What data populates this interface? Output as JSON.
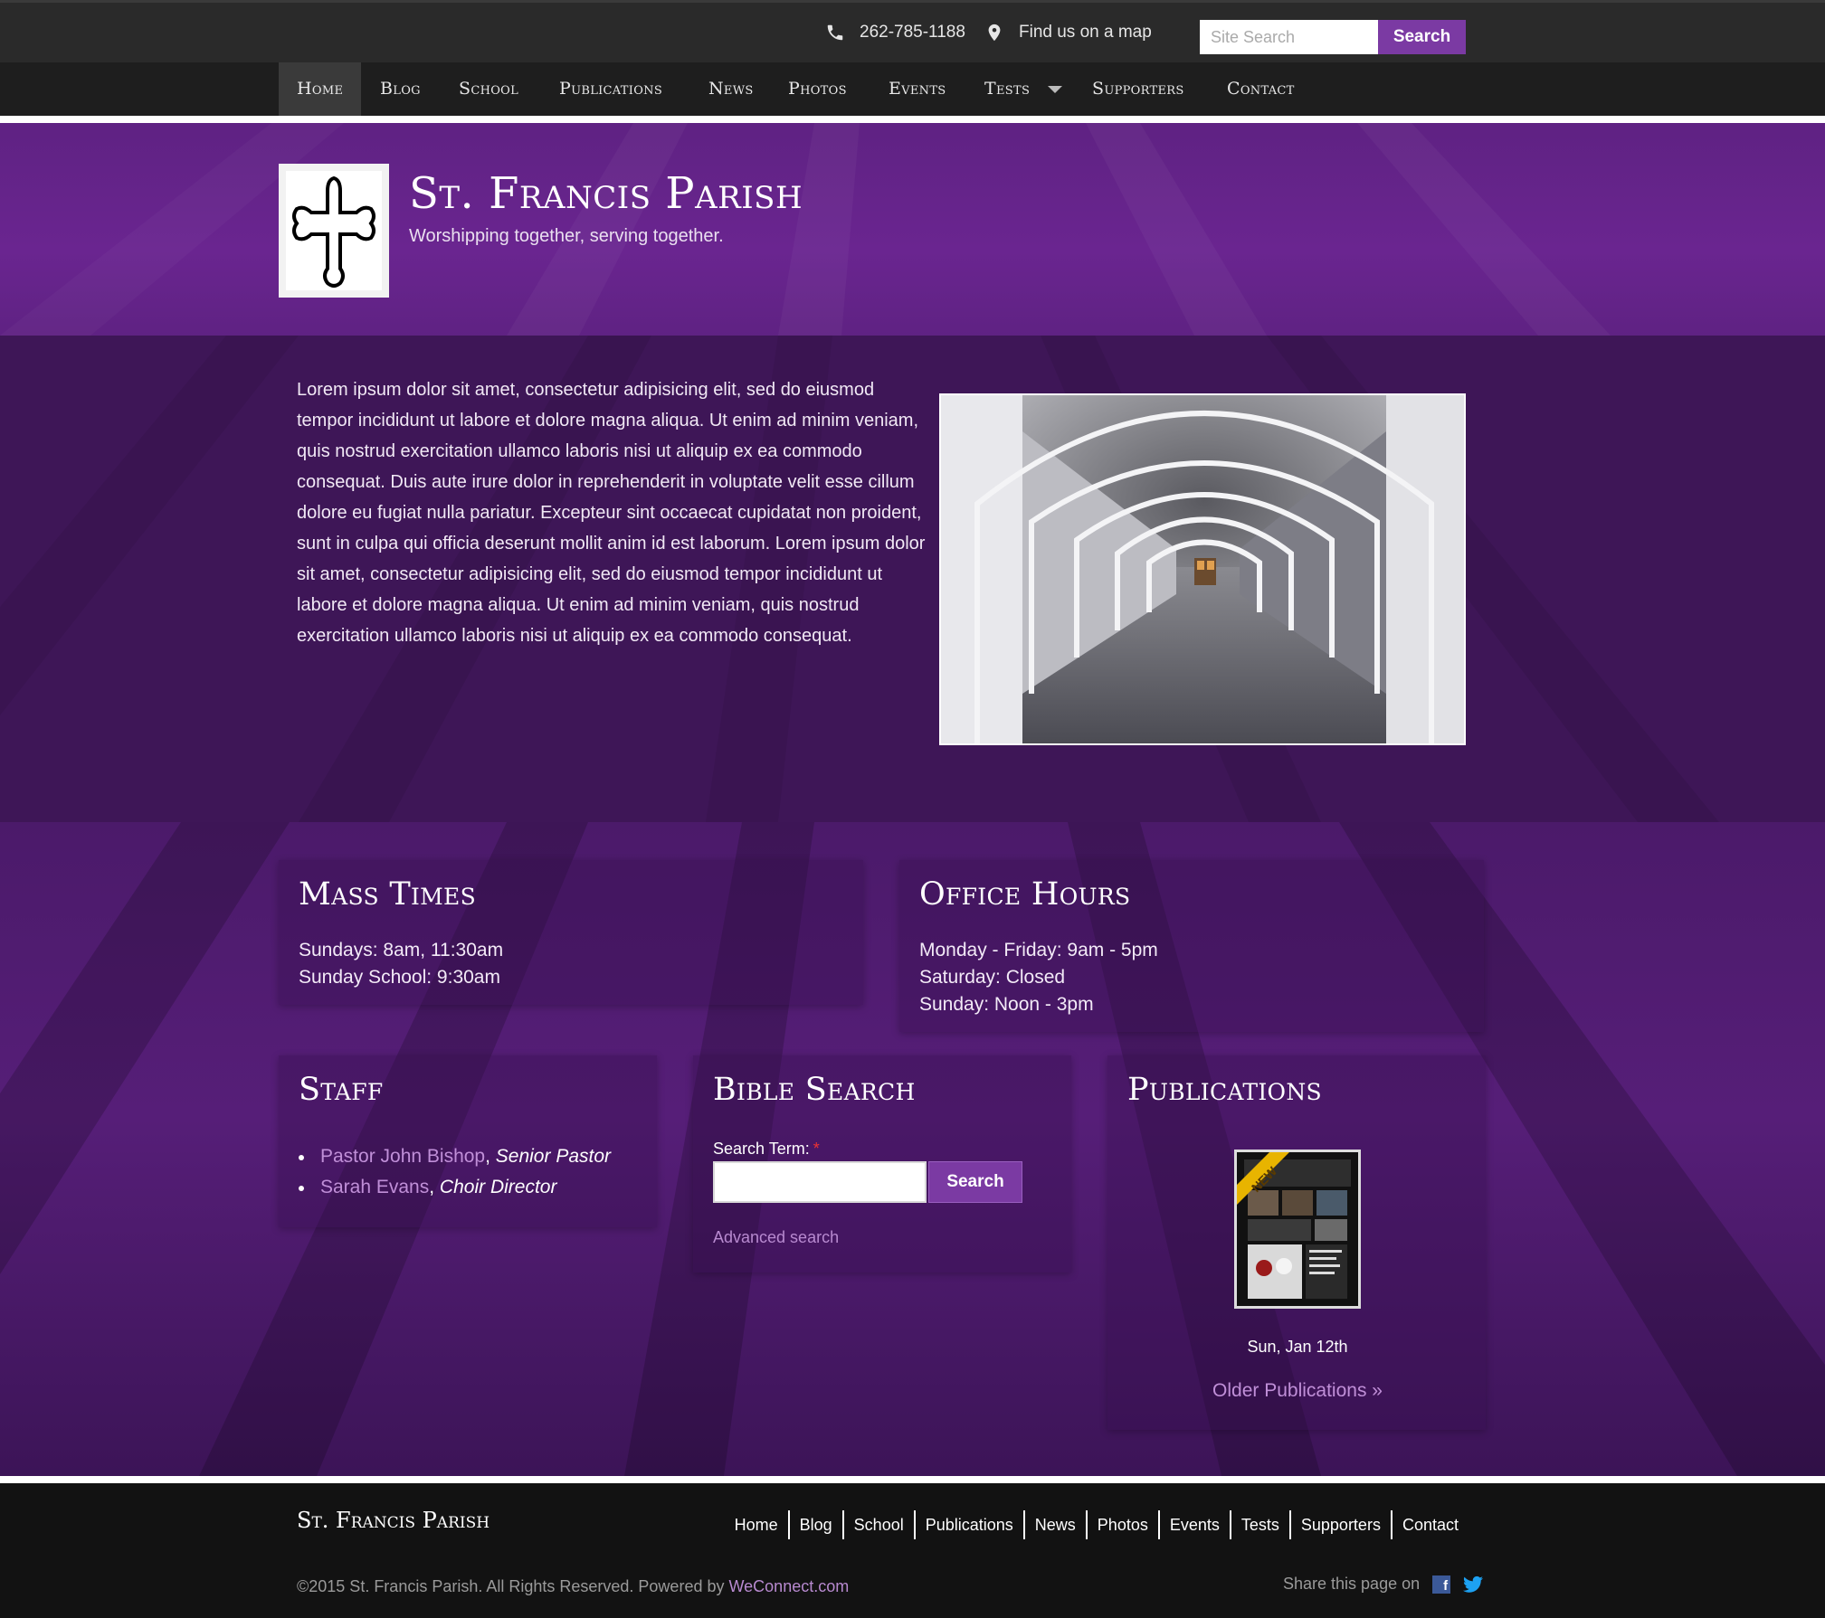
{
  "topbar": {
    "phone": "262-785-1188",
    "map_link": "Find us on a map",
    "search_placeholder": "Site Search",
    "search_button": "Search"
  },
  "nav": {
    "items": [
      "Home",
      "Blog",
      "School",
      "Publications",
      "News",
      "Photos",
      "Events",
      "Tests",
      "Supporters",
      "Contact"
    ],
    "active": "Home"
  },
  "header": {
    "title": "St. Francis Parish",
    "tagline": "Worshipping together, serving together."
  },
  "intro": {
    "text": "Lorem ipsum dolor sit amet, consectetur adipisicing elit, sed do eiusmod tempor incididunt ut labore et dolore magna aliqua. Ut enim ad minim veniam, quis nostrud exercitation ullamco laboris nisi ut aliquip ex ea commodo consequat. Duis aute irure dolor in reprehenderit in voluptate velit esse cillum dolore eu fugiat nulla pariatur. Excepteur sint occaecat cupidatat non proident, sunt in culpa qui officia deserunt mollit anim id est laborum. Lorem ipsum dolor sit amet, consectetur adipisicing elit, sed do eiusmod tempor incididunt ut labore et dolore magna aliqua. Ut enim ad minim veniam, quis nostrud exercitation ullamco laboris nisi ut aliquip ex ea commodo consequat."
  },
  "mass_times": {
    "title": "Mass Times",
    "lines": [
      "Sundays: 8am, 11:30am",
      "Sunday School: 9:30am"
    ]
  },
  "office_hours": {
    "title": "Office Hours",
    "lines": [
      "Monday - Friday: 9am - 5pm",
      "Saturday: Closed",
      "Sunday: Noon - 3pm"
    ]
  },
  "staff": {
    "title": "Staff",
    "members": [
      {
        "name": "Pastor John Bishop",
        "role": "Senior Pastor"
      },
      {
        "name": "Sarah Evans",
        "role": "Choir Director"
      }
    ]
  },
  "bible_search": {
    "title": "Bible Search",
    "label": "Search Term:",
    "required_mark": "*",
    "button": "Search",
    "advanced": "Advanced search"
  },
  "publications": {
    "title": "Publications",
    "badge": "NEW",
    "date": "Sun, Jan 12th",
    "older": "Older Publications »"
  },
  "footer": {
    "title": "St. Francis Parish",
    "links": [
      "Home",
      "Blog",
      "School",
      "Publications",
      "News",
      "Photos",
      "Events",
      "Tests",
      "Supporters",
      "Contact"
    ],
    "copyright": "©2015 St. Francis Parish. All Rights Reserved. Powered by",
    "powered_by": "WeConnect.com",
    "share_label": "Share this page on"
  },
  "colors": {
    "accent": "#7b3aa3",
    "link": "#c08fd8",
    "header_bg": "#6a2590",
    "intro_bg": "#3e1657"
  }
}
